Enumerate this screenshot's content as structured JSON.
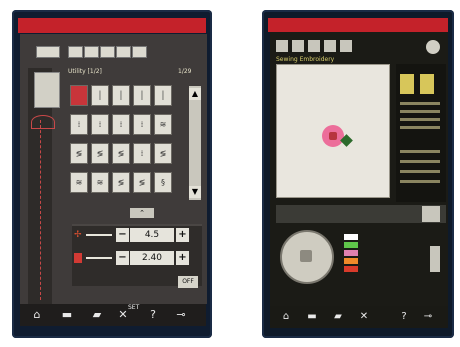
{
  "left_screen": {
    "page_indicator": "1/29",
    "header_label": "Utility [1/2]",
    "width_value": "4.5",
    "length_value": "2.40",
    "off_label": "OFF",
    "set_label": "SET",
    "minus": "−",
    "plus": "+",
    "help_label": "?"
  },
  "right_screen": {
    "header_label": "Sewing Embroidery",
    "help_label": "?",
    "colors": [
      "#ffffff",
      "#5fc64a",
      "#e080b0",
      "#f08a2a",
      "#d93b2b"
    ]
  }
}
